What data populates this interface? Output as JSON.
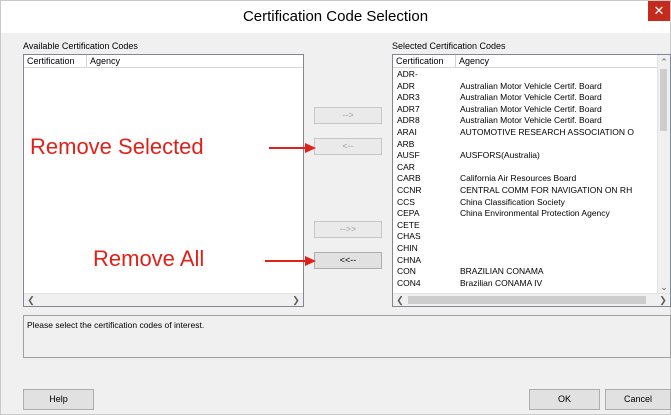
{
  "window": {
    "title": "Certification Code Selection",
    "close": "✕"
  },
  "available": {
    "label": "Available Certification Codes",
    "columns": [
      "Certification",
      "Agency"
    ]
  },
  "selected": {
    "label": "Selected Certification Codes",
    "columns": [
      "Certification",
      "Agency"
    ],
    "rows": [
      {
        "code": "ADR-",
        "agency": ""
      },
      {
        "code": "ADR",
        "agency": "Australian Motor Vehicle Certif. Board"
      },
      {
        "code": "ADR3",
        "agency": "Australian Motor Vehicle Certif. Board"
      },
      {
        "code": "ADR7",
        "agency": "Australian Motor Vehicle Certif. Board"
      },
      {
        "code": "ADR8",
        "agency": "Australian Motor Vehicle Certif. Board"
      },
      {
        "code": "ARAI",
        "agency": "AUTOMOTIVE RESEARCH ASSOCIATION O"
      },
      {
        "code": "ARB",
        "agency": ""
      },
      {
        "code": "AUSF",
        "agency": "AUSFORS(Australia)"
      },
      {
        "code": "CAR",
        "agency": ""
      },
      {
        "code": "CARB",
        "agency": "California Air Resources Board"
      },
      {
        "code": "CCNR",
        "agency": "CENTRAL COMM FOR NAVIGATION ON RH"
      },
      {
        "code": "CCS",
        "agency": "China Classification Society"
      },
      {
        "code": "CEPA",
        "agency": "China Environmental Protection Agency"
      },
      {
        "code": "CETE",
        "agency": ""
      },
      {
        "code": "CHAS",
        "agency": ""
      },
      {
        "code": "CHIN",
        "agency": ""
      },
      {
        "code": "CHNA",
        "agency": ""
      },
      {
        "code": "CON",
        "agency": "BRAZILIAN CONAMA"
      },
      {
        "code": "CON4",
        "agency": "Brazilian CONAMA IV"
      }
    ]
  },
  "buttons": {
    "add_selected": "-->",
    "remove_selected": "<--",
    "add_all": "-->>",
    "remove_all": "<<--",
    "help": "Help",
    "ok": "OK",
    "cancel": "Cancel"
  },
  "status_text": "Please select the certification codes of interest.",
  "annotations": {
    "remove_selected": "Remove Selected",
    "remove_all": "Remove All"
  },
  "colors": {
    "annotation": "#e0211a",
    "close_bg": "#c42b1c"
  }
}
